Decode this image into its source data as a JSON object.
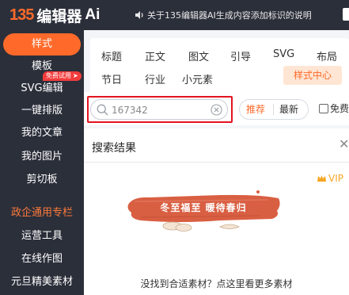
{
  "header": {
    "logo_num": "135",
    "logo_text": "编辑器",
    "logo_ai": "Ai",
    "notice": "关于135编辑器AI生成内容添加标识的说明"
  },
  "sidebar": {
    "items": [
      {
        "label": "样式",
        "active": true
      },
      {
        "label": "模板"
      },
      {
        "label": "SVG编辑",
        "badge": "免费试用"
      },
      {
        "label": "一键排版"
      },
      {
        "label": "我的文章"
      },
      {
        "label": "我的图片"
      },
      {
        "label": "剪切板"
      },
      {
        "label": "政企通用专栏",
        "section": true
      },
      {
        "label": "运营工具"
      },
      {
        "label": "在线作图"
      },
      {
        "label": "元旦精美素材"
      }
    ]
  },
  "categories": {
    "row1": [
      "标题",
      "正文",
      "图文",
      "引导",
      "SVG",
      "布局"
    ],
    "row2": [
      "节日",
      "行业",
      "小元素"
    ],
    "style_center": "样式中心"
  },
  "search": {
    "value": "167342",
    "tabs": [
      "推荐",
      "最新"
    ],
    "free_label": "免费"
  },
  "results": {
    "title": "搜索结果",
    "vip_label": "VIP",
    "banner_text": "冬至福至 暖待春归",
    "empty_message": "没找到合适素材？点这里看更多素材"
  },
  "colors": {
    "accent": "#ff6a2a",
    "sidebar_bg": "#2b2f3a",
    "highlight_frame": "#e3141f",
    "vip": "#f5a623"
  }
}
